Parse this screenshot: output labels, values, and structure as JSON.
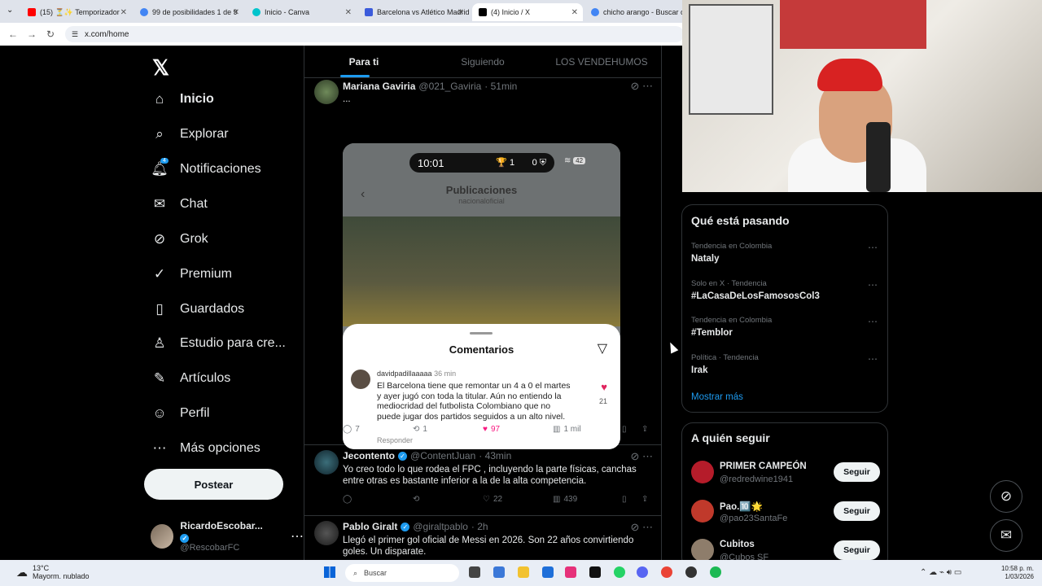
{
  "browser": {
    "tabs": [
      {
        "label": "(15) ⏳✨ Temporizador",
        "color": "#ff0000"
      },
      {
        "label": "99 de posibilidades 1 de 9",
        "color": "#4285f4"
      },
      {
        "label": "Inicio - Canva",
        "color": "#00c4cc"
      },
      {
        "label": "Barcelona vs Atlético Madrid",
        "color": "#3b5bdb"
      },
      {
        "label": "(4) Inicio / X",
        "color": "#000000"
      },
      {
        "label": "chicho arango - Buscar con Google",
        "color": "#4285f4"
      }
    ],
    "url": "x.com/home"
  },
  "sidebar": {
    "logo": "𝕏",
    "items": [
      {
        "label": "Inicio",
        "icon": "home-icon",
        "glyph": "⌂"
      },
      {
        "label": "Explorar",
        "icon": "search-icon",
        "glyph": "⌕"
      },
      {
        "label": "Notificaciones",
        "icon": "bell-icon",
        "glyph": "♫"
      },
      {
        "label": "Chat",
        "icon": "mail-icon",
        "glyph": "✉"
      },
      {
        "label": "Grok",
        "icon": "grok-icon",
        "glyph": "⊘"
      },
      {
        "label": "Premium",
        "icon": "verified-icon",
        "glyph": "✓"
      },
      {
        "label": "Guardados",
        "icon": "bookmark-icon",
        "glyph": "▯"
      },
      {
        "label": "Estudio para cre...",
        "icon": "studio-icon",
        "glyph": "♙"
      },
      {
        "label": "Artículos",
        "icon": "article-icon",
        "glyph": "✎"
      },
      {
        "label": "Perfil",
        "icon": "profile-icon",
        "glyph": "☺"
      },
      {
        "label": "Más opciones",
        "icon": "more-options-icon",
        "glyph": "⋯"
      }
    ],
    "notif_badge": "4",
    "post_label": "Postear",
    "profile_name": "RicardoEscobar...",
    "profile_handle": "@RescobarFC"
  },
  "feed": {
    "tabs": [
      "Para ti",
      "Siguiendo",
      "LOS VENDEHUMOS"
    ],
    "tweets": [
      {
        "name": "Mariana Gaviria",
        "handle": "@021_Gaviria",
        "time": "· 51min",
        "text": "...",
        "replies": "7",
        "reposts": "1",
        "likes": "97",
        "views": "1 mil",
        "media": {
          "time": "10:01",
          "score_left": "1",
          "score_right": "0",
          "battery": "42",
          "title": "Publicaciones",
          "subtitle": "nacionaloficial",
          "sheet_title": "Comentarios",
          "comment_user": "davidpadillaaaaa",
          "comment_time": "36 min",
          "comment_text": "El Barcelona tiene que remontar un 4 a 0 el martes y ayer jugó con toda la titular. Aún no entiendo la mediocridad del futbolista Colombiano que no puede jugar dos partidos seguidos a un alto nivel.",
          "comment_likes": "21",
          "reply_label": "Responder"
        }
      },
      {
        "name": "Jecontento",
        "handle": "@ContentJuan",
        "time": "· 43min",
        "text": "Yo creo todo lo que rodea el FPC , incluyendo la parte físicas, canchas entre otras es bastante inferior a la de la alta competencia.",
        "replies": "",
        "reposts": "",
        "likes": "22",
        "views": "439"
      },
      {
        "name": "Pablo Giralt",
        "handle": "@giraltpablo",
        "time": "· 2h",
        "text": "Llegó el primer gol oficial de Messi en 2026. Son 22 años convirtiendo goles. Un disparate."
      }
    ]
  },
  "trends": {
    "title": "Qué está pasando",
    "items": [
      {
        "context": "Tendencia en Colombia",
        "name": "Nataly"
      },
      {
        "context": "Solo en X · Tendencia",
        "name": "#LaCasaDeLosFamososCol3"
      },
      {
        "context": "Tendencia en Colombia",
        "name": "#Temblor"
      },
      {
        "context": "Política · Tendencia",
        "name": "Irak"
      }
    ],
    "show_more": "Mostrar más"
  },
  "who_to_follow": {
    "title": "A quién seguir",
    "items": [
      {
        "name": "PRIMER CAMPEÓN",
        "handle": "@redredwine1941",
        "button": "Seguir",
        "color": "#b51c2a"
      },
      {
        "name": "Pao.🔟🌟",
        "handle": "@pao23SantaFe",
        "button": "Seguir",
        "color": "#c0392b"
      },
      {
        "name": "Cubitos",
        "handle": "@Cubos SF",
        "button": "Seguir",
        "color": "#8e7d6b"
      }
    ]
  },
  "taskbar": {
    "temp": "13°C",
    "weather": "Mayorm. nublado",
    "search_placeholder": "Buscar",
    "time": "10:58 p. m.",
    "date": "1/03/2026"
  }
}
